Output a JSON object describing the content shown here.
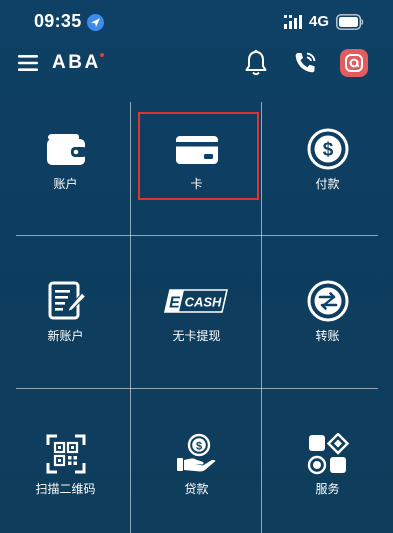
{
  "status_bar": {
    "time": "09:35",
    "network": "4G",
    "icons": [
      "location-arrow-icon",
      "signal-bars-icon",
      "battery-icon"
    ]
  },
  "header": {
    "logo": "ABA",
    "icons": [
      "menu-icon",
      "bell-icon",
      "phone-call-icon",
      "chat-icon"
    ],
    "accent_color": "#e25b5e"
  },
  "tiles": [
    {
      "label": "账户",
      "icon": "wallet-icon"
    },
    {
      "label": "卡",
      "icon": "card-icon"
    },
    {
      "label": "付款",
      "icon": "dollar-coin-icon"
    },
    {
      "label": "新账户",
      "icon": "form-pen-icon"
    },
    {
      "label": "无卡提现",
      "icon": "ecash-icon",
      "icon_text": "CASH",
      "icon_letter": "E"
    },
    {
      "label": "转账",
      "icon": "transfer-icon"
    },
    {
      "label": "扫描二维码",
      "icon": "qr-scan-icon"
    },
    {
      "label": "贷款",
      "icon": "loan-hand-icon"
    },
    {
      "label": "服务",
      "icon": "services-icon"
    }
  ],
  "selection": {
    "selected_tile": "卡",
    "highlight_color": "#e0322f"
  }
}
